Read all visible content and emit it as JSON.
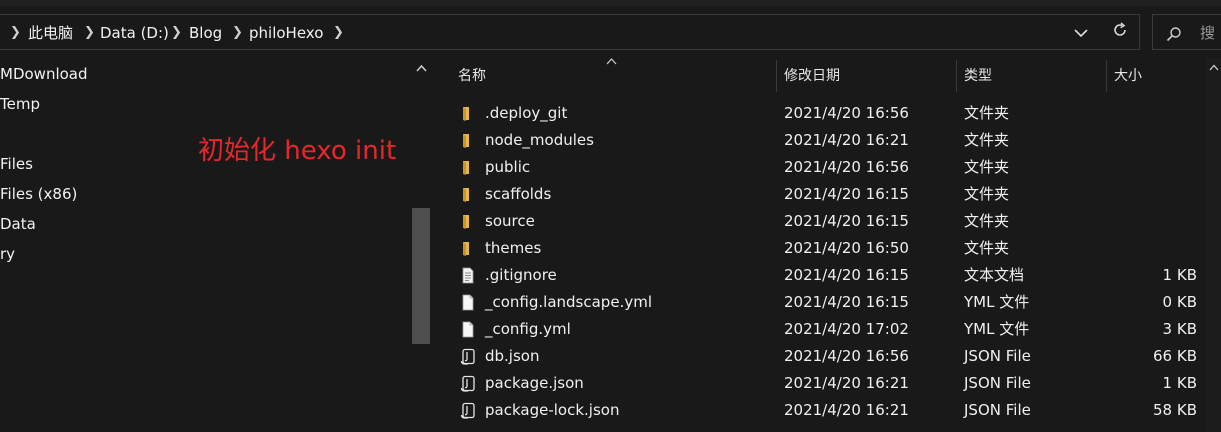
{
  "address_bar": {
    "crumbs": [
      "此电脑",
      "Data (D:)",
      "Blog",
      "philoHexo"
    ],
    "search_placeholder": "搜"
  },
  "nav_pane": {
    "items": [
      "MDownload",
      "Temp",
      "Files",
      "Files (x86)",
      "Data",
      "ry"
    ]
  },
  "annotation": "初始化 hexo init",
  "columns": {
    "name": "名称",
    "date": "修改日期",
    "type": "类型",
    "size": "大小"
  },
  "files": [
    {
      "name": ".deploy_git",
      "date": "2021/4/20 16:56",
      "type": "文件夹",
      "size": "",
      "icon": "folder-icon"
    },
    {
      "name": "node_modules",
      "date": "2021/4/20 16:21",
      "type": "文件夹",
      "size": "",
      "icon": "folder-icon"
    },
    {
      "name": "public",
      "date": "2021/4/20 16:56",
      "type": "文件夹",
      "size": "",
      "icon": "folder-icon"
    },
    {
      "name": "scaffolds",
      "date": "2021/4/20 16:15",
      "type": "文件夹",
      "size": "",
      "icon": "folder-icon"
    },
    {
      "name": "source",
      "date": "2021/4/20 16:15",
      "type": "文件夹",
      "size": "",
      "icon": "folder-icon"
    },
    {
      "name": "themes",
      "date": "2021/4/20 16:50",
      "type": "文件夹",
      "size": "",
      "icon": "folder-icon"
    },
    {
      "name": ".gitignore",
      "date": "2021/4/20 16:15",
      "type": "文本文档",
      "size": "1 KB",
      "icon": "text-file-icon"
    },
    {
      "name": "_config.landscape.yml",
      "date": "2021/4/20 16:15",
      "type": "YML 文件",
      "size": "0 KB",
      "icon": "file-icon"
    },
    {
      "name": "_config.yml",
      "date": "2021/4/20 17:02",
      "type": "YML 文件",
      "size": "3 KB",
      "icon": "file-icon"
    },
    {
      "name": "db.json",
      "date": "2021/4/20 16:56",
      "type": "JSON File",
      "size": "66 KB",
      "icon": "json-file-icon"
    },
    {
      "name": "package.json",
      "date": "2021/4/20 16:21",
      "type": "JSON File",
      "size": "1 KB",
      "icon": "json-file-icon"
    },
    {
      "name": "package-lock.json",
      "date": "2021/4/20 16:21",
      "type": "JSON File",
      "size": "58 KB",
      "icon": "json-file-icon"
    }
  ],
  "colors": {
    "background": "#191919",
    "folder": "#e8b54a",
    "annotation": "#e8262a"
  }
}
